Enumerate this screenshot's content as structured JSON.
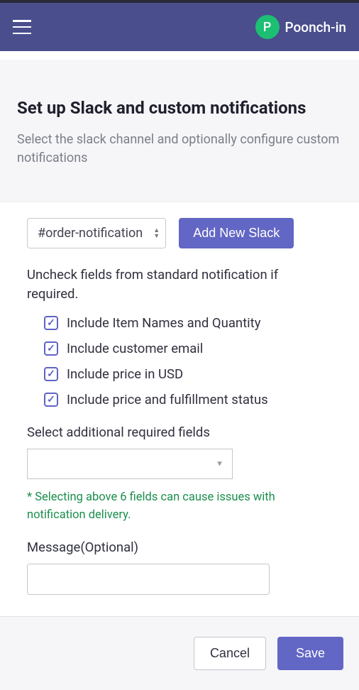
{
  "header": {
    "avatar_initial": "P",
    "tenant_name": "Poonch-in"
  },
  "page": {
    "title": "Set up Slack and custom notifications",
    "subtitle": "Select the slack channel and optionally configure custom notifications"
  },
  "slack": {
    "selected_channel": "#order-notification",
    "add_button_label": "Add New Slack"
  },
  "fields": {
    "uncheck_label": "Uncheck fields from standard notification if required.",
    "checkboxes": [
      {
        "label": "Include Item Names and Quantity",
        "checked": true
      },
      {
        "label": "Include customer email",
        "checked": true
      },
      {
        "label": "Include price in USD",
        "checked": true
      },
      {
        "label": "Include price and fulfillment status",
        "checked": true
      }
    ]
  },
  "additional": {
    "label": "Select additional required fields",
    "warning": "* Selecting above 6 fields can cause issues with notification delivery."
  },
  "message": {
    "label": "Message(Optional)",
    "value": ""
  },
  "footer": {
    "cancel_label": "Cancel",
    "save_label": "Save"
  }
}
